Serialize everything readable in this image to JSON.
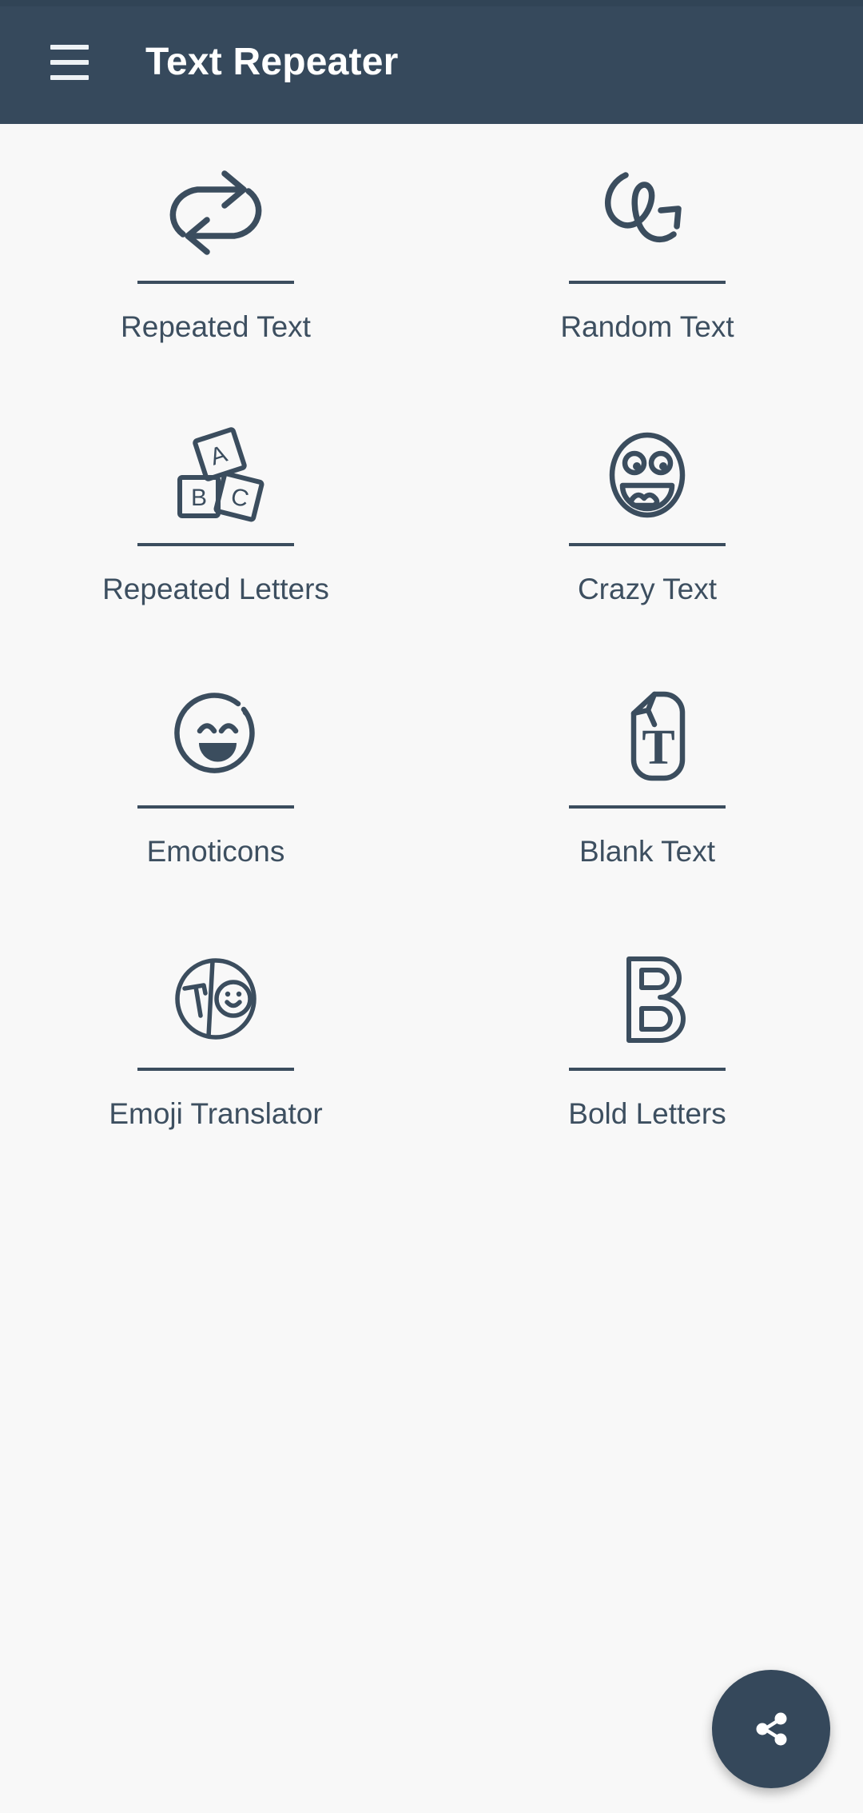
{
  "appbar": {
    "title": "Text Repeater",
    "menu_icon": "hamburger-menu-icon",
    "background_color": "#36495c",
    "title_color": "#ffffff"
  },
  "theme": {
    "page_background": "#f8f8f8",
    "icon_stroke": "#3b4d5e",
    "label_color": "#3d4f60",
    "divider_color": "#3b4d5e",
    "fab_background": "#35485b",
    "fab_icon_color": "#ffffff"
  },
  "grid": {
    "columns": 2,
    "tiles": [
      {
        "label": "Repeated Text",
        "icon": "repeat-loop-arrows-icon"
      },
      {
        "label": "Random Text",
        "icon": "scribble-squiggle-arrow-icon"
      },
      {
        "label": "Repeated Letters",
        "icon": "abc-blocks-icon"
      },
      {
        "label": "Crazy Text",
        "icon": "crazy-laughing-face-icon"
      },
      {
        "label": "Emoticons",
        "icon": "smiling-face-icon"
      },
      {
        "label": "Blank Text",
        "icon": "document-folded-corner-t-icon"
      },
      {
        "label": "Emoji Translator",
        "icon": "split-circle-t-smiley-icon"
      },
      {
        "label": "Bold Letters",
        "icon": "outlined-letter-b-icon"
      }
    ]
  },
  "fab": {
    "icon": "share-icon",
    "label": "Share"
  }
}
